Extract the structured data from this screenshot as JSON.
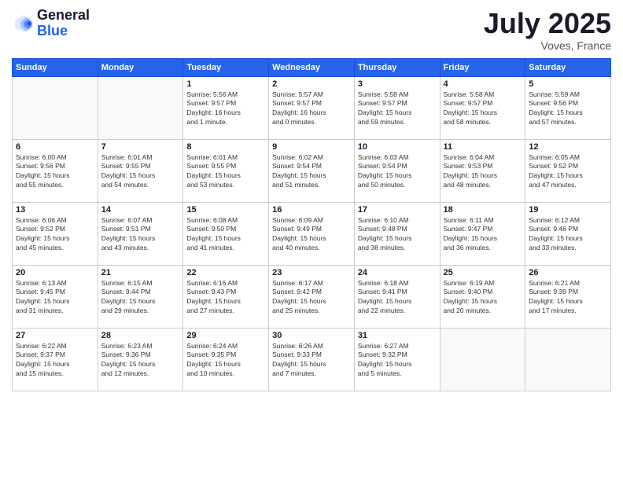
{
  "header": {
    "logo_line1": "General",
    "logo_line2": "Blue",
    "month_title": "July 2025",
    "location": "Voves, France"
  },
  "weekdays": [
    "Sunday",
    "Monday",
    "Tuesday",
    "Wednesday",
    "Thursday",
    "Friday",
    "Saturday"
  ],
  "weeks": [
    [
      {
        "day": "",
        "info": ""
      },
      {
        "day": "",
        "info": ""
      },
      {
        "day": "1",
        "info": "Sunrise: 5:56 AM\nSunset: 9:57 PM\nDaylight: 16 hours\nand 1 minute."
      },
      {
        "day": "2",
        "info": "Sunrise: 5:57 AM\nSunset: 9:57 PM\nDaylight: 16 hours\nand 0 minutes."
      },
      {
        "day": "3",
        "info": "Sunrise: 5:58 AM\nSunset: 9:57 PM\nDaylight: 15 hours\nand 59 minutes."
      },
      {
        "day": "4",
        "info": "Sunrise: 5:58 AM\nSunset: 9:57 PM\nDaylight: 15 hours\nand 58 minutes."
      },
      {
        "day": "5",
        "info": "Sunrise: 5:59 AM\nSunset: 9:56 PM\nDaylight: 15 hours\nand 57 minutes."
      }
    ],
    [
      {
        "day": "6",
        "info": "Sunrise: 6:00 AM\nSunset: 9:56 PM\nDaylight: 15 hours\nand 55 minutes."
      },
      {
        "day": "7",
        "info": "Sunrise: 6:01 AM\nSunset: 9:55 PM\nDaylight: 15 hours\nand 54 minutes."
      },
      {
        "day": "8",
        "info": "Sunrise: 6:01 AM\nSunset: 9:55 PM\nDaylight: 15 hours\nand 53 minutes."
      },
      {
        "day": "9",
        "info": "Sunrise: 6:02 AM\nSunset: 9:54 PM\nDaylight: 15 hours\nand 51 minutes."
      },
      {
        "day": "10",
        "info": "Sunrise: 6:03 AM\nSunset: 9:54 PM\nDaylight: 15 hours\nand 50 minutes."
      },
      {
        "day": "11",
        "info": "Sunrise: 6:04 AM\nSunset: 9:53 PM\nDaylight: 15 hours\nand 48 minutes."
      },
      {
        "day": "12",
        "info": "Sunrise: 6:05 AM\nSunset: 9:52 PM\nDaylight: 15 hours\nand 47 minutes."
      }
    ],
    [
      {
        "day": "13",
        "info": "Sunrise: 6:06 AM\nSunset: 9:52 PM\nDaylight: 15 hours\nand 45 minutes."
      },
      {
        "day": "14",
        "info": "Sunrise: 6:07 AM\nSunset: 9:51 PM\nDaylight: 15 hours\nand 43 minutes."
      },
      {
        "day": "15",
        "info": "Sunrise: 6:08 AM\nSunset: 9:50 PM\nDaylight: 15 hours\nand 41 minutes."
      },
      {
        "day": "16",
        "info": "Sunrise: 6:09 AM\nSunset: 9:49 PM\nDaylight: 15 hours\nand 40 minutes."
      },
      {
        "day": "17",
        "info": "Sunrise: 6:10 AM\nSunset: 9:48 PM\nDaylight: 15 hours\nand 38 minutes."
      },
      {
        "day": "18",
        "info": "Sunrise: 6:11 AM\nSunset: 9:47 PM\nDaylight: 15 hours\nand 36 minutes."
      },
      {
        "day": "19",
        "info": "Sunrise: 6:12 AM\nSunset: 9:46 PM\nDaylight: 15 hours\nand 33 minutes."
      }
    ],
    [
      {
        "day": "20",
        "info": "Sunrise: 6:13 AM\nSunset: 9:45 PM\nDaylight: 15 hours\nand 31 minutes."
      },
      {
        "day": "21",
        "info": "Sunrise: 6:15 AM\nSunset: 9:44 PM\nDaylight: 15 hours\nand 29 minutes."
      },
      {
        "day": "22",
        "info": "Sunrise: 6:16 AM\nSunset: 9:43 PM\nDaylight: 15 hours\nand 27 minutes."
      },
      {
        "day": "23",
        "info": "Sunrise: 6:17 AM\nSunset: 9:42 PM\nDaylight: 15 hours\nand 25 minutes."
      },
      {
        "day": "24",
        "info": "Sunrise: 6:18 AM\nSunset: 9:41 PM\nDaylight: 15 hours\nand 22 minutes."
      },
      {
        "day": "25",
        "info": "Sunrise: 6:19 AM\nSunset: 9:40 PM\nDaylight: 15 hours\nand 20 minutes."
      },
      {
        "day": "26",
        "info": "Sunrise: 6:21 AM\nSunset: 9:39 PM\nDaylight: 15 hours\nand 17 minutes."
      }
    ],
    [
      {
        "day": "27",
        "info": "Sunrise: 6:22 AM\nSunset: 9:37 PM\nDaylight: 15 hours\nand 15 minutes."
      },
      {
        "day": "28",
        "info": "Sunrise: 6:23 AM\nSunset: 9:36 PM\nDaylight: 15 hours\nand 12 minutes."
      },
      {
        "day": "29",
        "info": "Sunrise: 6:24 AM\nSunset: 9:35 PM\nDaylight: 15 hours\nand 10 minutes."
      },
      {
        "day": "30",
        "info": "Sunrise: 6:26 AM\nSunset: 9:33 PM\nDaylight: 15 hours\nand 7 minutes."
      },
      {
        "day": "31",
        "info": "Sunrise: 6:27 AM\nSunset: 9:32 PM\nDaylight: 15 hours\nand 5 minutes."
      },
      {
        "day": "",
        "info": ""
      },
      {
        "day": "",
        "info": ""
      }
    ]
  ]
}
